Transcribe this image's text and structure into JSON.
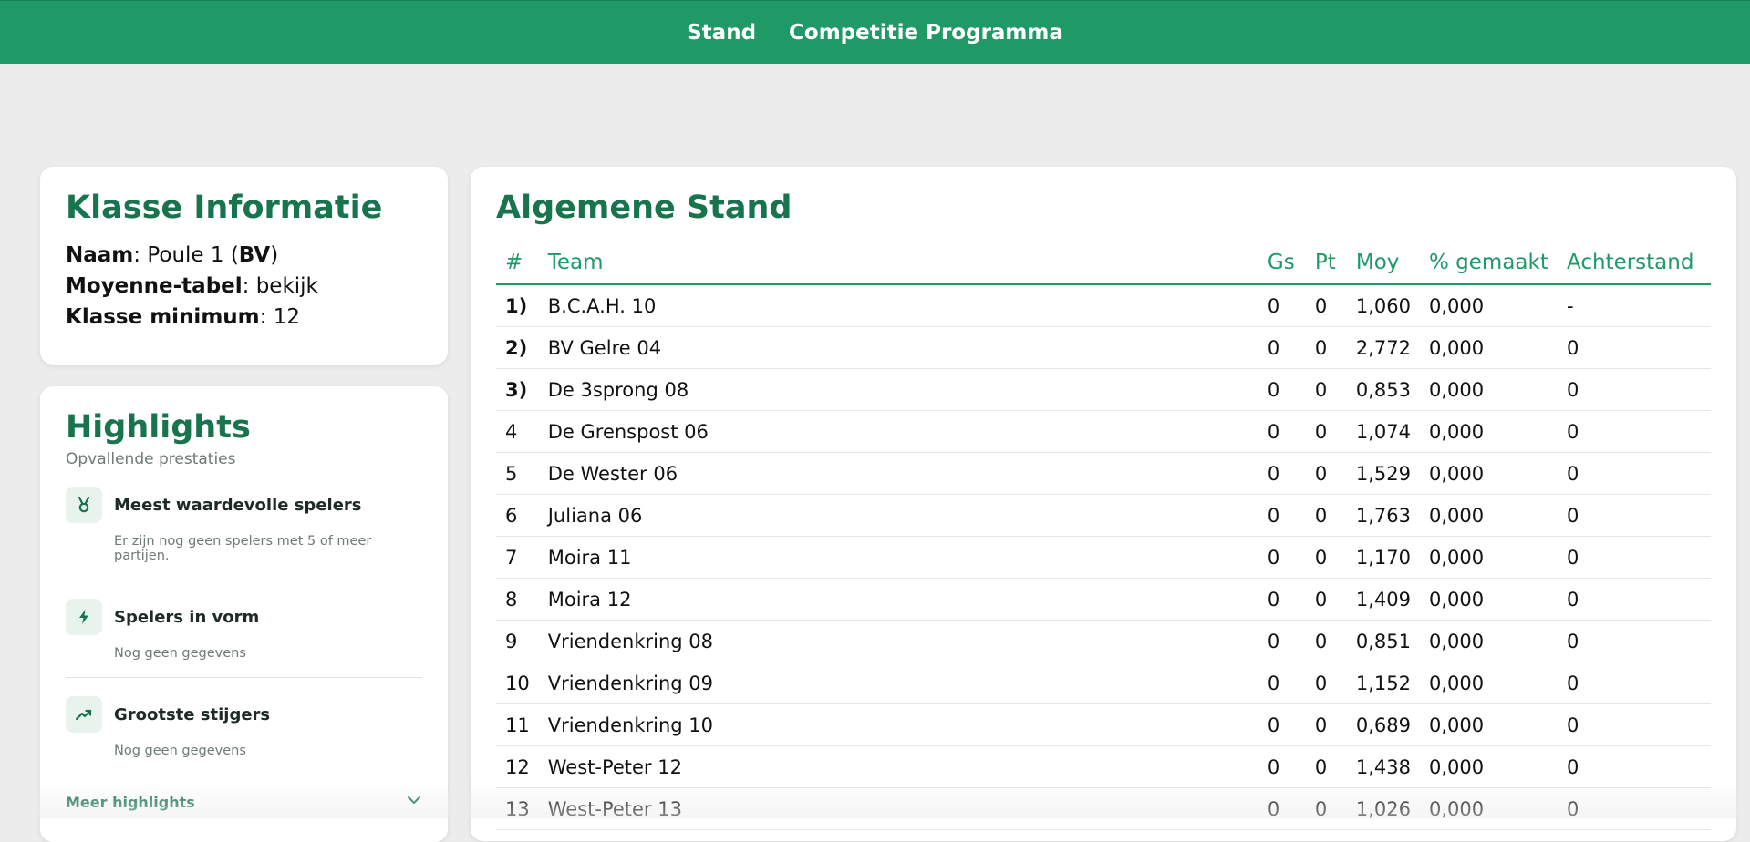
{
  "nav": {
    "items": [
      {
        "label": "Stand"
      },
      {
        "label": "Competitie Programma"
      }
    ]
  },
  "colors": {
    "brand_green": "#1f9a67",
    "title_green": "#17744d",
    "background": "#ececec"
  },
  "info": {
    "title": "Klasse Informatie",
    "name_label": "Naam",
    "name_value_prefix": ": Poule 1 (",
    "name_value_bold": "BV",
    "name_value_suffix": ")",
    "moyenne_label": "Moyenne-tabel",
    "moyenne_sep": ": ",
    "moyenne_link": "bekijk",
    "minimum_label": "Klasse minimum",
    "minimum_value": ": 12"
  },
  "highlights": {
    "title": "Highlights",
    "subtitle": "Opvallende prestaties",
    "items": [
      {
        "title": "Meest waardevolle spelers",
        "desc": "Er zijn nog geen spelers met 5 of meer partijen.",
        "icon": "medal-icon"
      },
      {
        "title": "Spelers in vorm",
        "desc": "Nog geen gegevens",
        "icon": "lightning-icon"
      },
      {
        "title": "Grootste stijgers",
        "desc": "Nog geen gegevens",
        "icon": "trending-up-icon"
      }
    ],
    "more_label": "Meer highlights"
  },
  "standings": {
    "title": "Algemene Stand",
    "columns": [
      "#",
      "Team",
      "Gs",
      "Pt",
      "Moy",
      "% gemaakt",
      "Achterstand"
    ],
    "rows": [
      {
        "rank": "1)",
        "team": "B.C.A.H. 10",
        "gs": "0",
        "pt": "0",
        "moy": "1,060",
        "pct": "0,000",
        "achter": "-"
      },
      {
        "rank": "2)",
        "team": "BV Gelre 04",
        "gs": "0",
        "pt": "0",
        "moy": "2,772",
        "pct": "0,000",
        "achter": "0"
      },
      {
        "rank": "3)",
        "team": "De 3sprong 08",
        "gs": "0",
        "pt": "0",
        "moy": "0,853",
        "pct": "0,000",
        "achter": "0"
      },
      {
        "rank": "4",
        "team": "De Grenspost 06",
        "gs": "0",
        "pt": "0",
        "moy": "1,074",
        "pct": "0,000",
        "achter": "0"
      },
      {
        "rank": "5",
        "team": "De Wester 06",
        "gs": "0",
        "pt": "0",
        "moy": "1,529",
        "pct": "0,000",
        "achter": "0"
      },
      {
        "rank": "6",
        "team": "Juliana 06",
        "gs": "0",
        "pt": "0",
        "moy": "1,763",
        "pct": "0,000",
        "achter": "0"
      },
      {
        "rank": "7",
        "team": "Moira 11",
        "gs": "0",
        "pt": "0",
        "moy": "1,170",
        "pct": "0,000",
        "achter": "0"
      },
      {
        "rank": "8",
        "team": "Moira 12",
        "gs": "0",
        "pt": "0",
        "moy": "1,409",
        "pct": "0,000",
        "achter": "0"
      },
      {
        "rank": "9",
        "team": "Vriendenkring 08",
        "gs": "0",
        "pt": "0",
        "moy": "0,851",
        "pct": "0,000",
        "achter": "0"
      },
      {
        "rank": "10",
        "team": "Vriendenkring 09",
        "gs": "0",
        "pt": "0",
        "moy": "1,152",
        "pct": "0,000",
        "achter": "0"
      },
      {
        "rank": "11",
        "team": "Vriendenkring 10",
        "gs": "0",
        "pt": "0",
        "moy": "0,689",
        "pct": "0,000",
        "achter": "0"
      },
      {
        "rank": "12",
        "team": "West-Peter 12",
        "gs": "0",
        "pt": "0",
        "moy": "1,438",
        "pct": "0,000",
        "achter": "0"
      },
      {
        "rank": "13",
        "team": "West-Peter 13",
        "gs": "0",
        "pt": "0",
        "moy": "1,026",
        "pct": "0,000",
        "achter": "0"
      }
    ]
  }
}
